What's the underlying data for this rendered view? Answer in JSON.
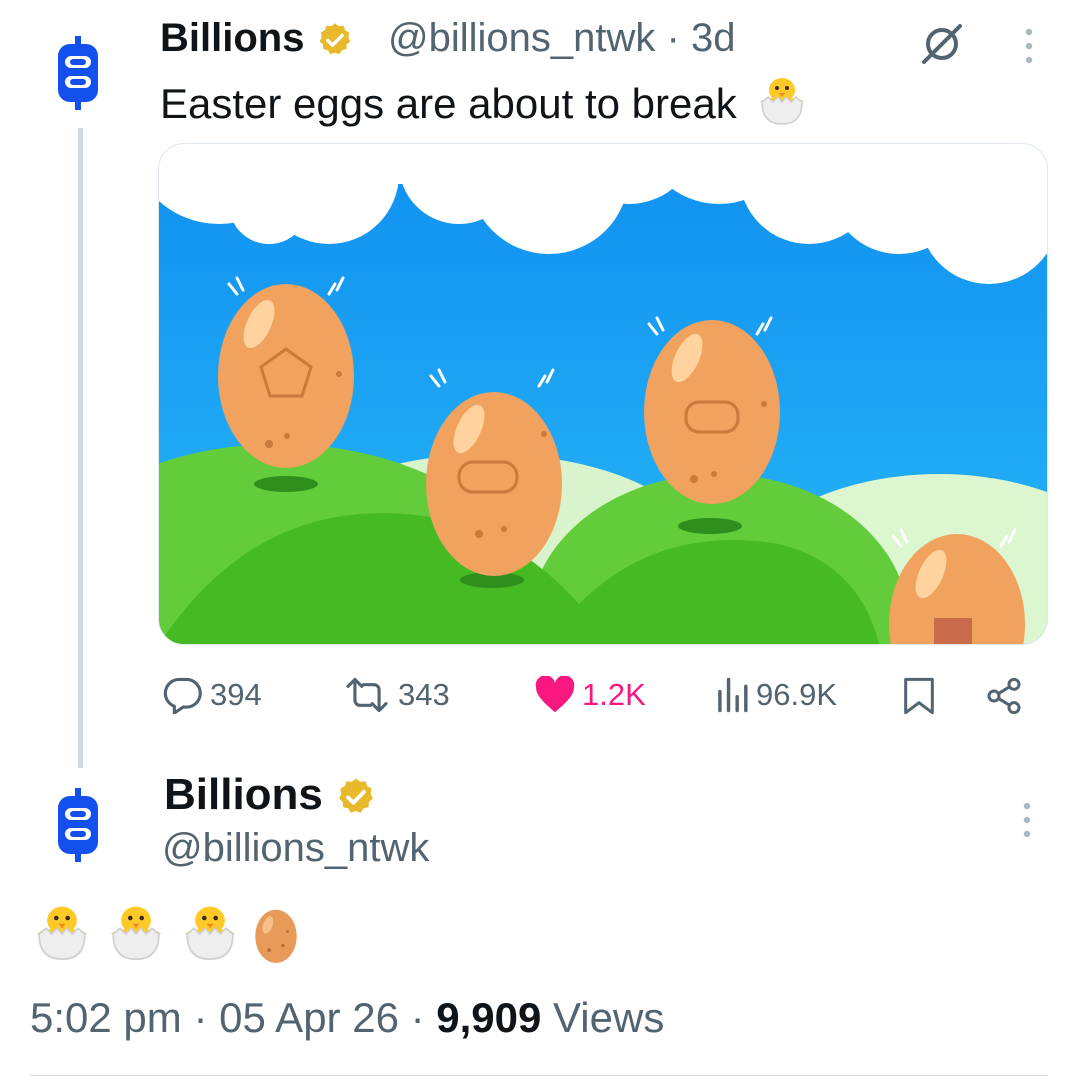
{
  "thread": {
    "author_name": "Billions",
    "author_handle": "@billions_ntwk",
    "separator": "·",
    "time_ago": "3d",
    "text": "Easter eggs are about to break",
    "actions": {
      "replies": "394",
      "reposts": "343",
      "likes": "1.2K",
      "views": "96.9K"
    }
  },
  "main_post": {
    "author_name": "Billions",
    "author_handle": "@billions_ntwk",
    "time": "5:02 pm",
    "date": "05 Apr 26",
    "views_count": "9,909",
    "views_label": "Views",
    "separator": "·"
  },
  "colors": {
    "brand_blue": "#1450f0",
    "verified_gold": "#e8b92b",
    "like_pink": "#f91880",
    "sky": "#1da1f2",
    "hill_green": "#4cc437",
    "egg": "#f0a25e"
  },
  "icons": [
    "billions-logo-icon",
    "verified-badge-icon",
    "grok-icon",
    "more-icon",
    "hatching-chick-icon",
    "reply-icon",
    "repost-icon",
    "like-icon",
    "views-icon",
    "bookmark-icon",
    "share-icon",
    "egg-icon"
  ]
}
